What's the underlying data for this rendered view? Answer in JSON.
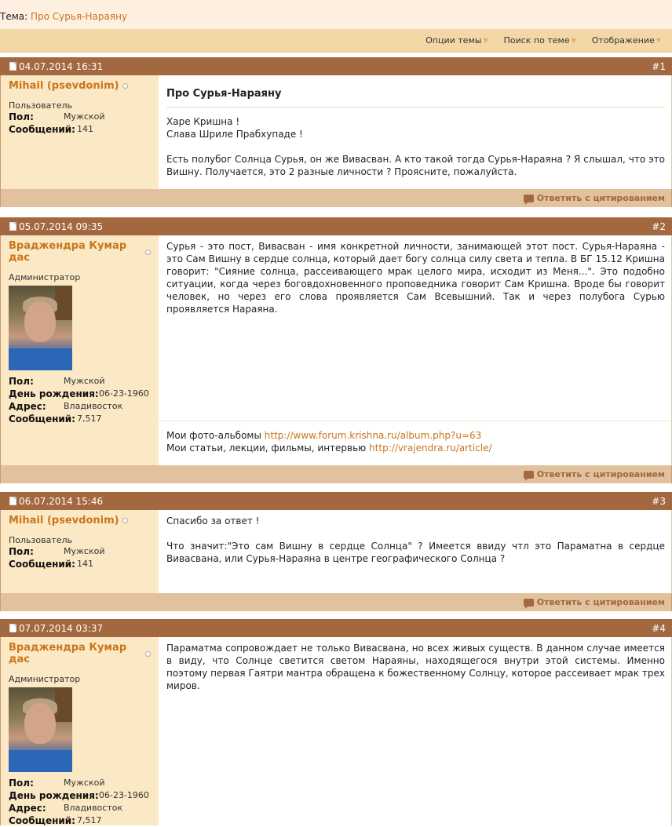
{
  "topic": {
    "prefix": "Тема:",
    "title": "Про Сурья-Нараяну"
  },
  "tools": [
    "Опции темы",
    "Поиск по теме",
    "Отображение"
  ],
  "posts": [
    {
      "date": "04.07.2014 16:31",
      "num": "#1",
      "username": "Mihail (psevdonim)",
      "usertitle": "Пользователь",
      "info": [
        {
          "k": "Пол:",
          "v": "Мужской"
        },
        {
          "k": "Сообщений:",
          "v": "141"
        }
      ],
      "title": "Про Сурья-Нараяну",
      "paragraphs": [
        "Харе Кришна !",
        "Слава Шриле Прабхупаде !",
        "",
        "Есть полубог Солнца Сурья, он же Вивасван. А кто такой тогда Сурья-Нараяна ? Я слышал, что это Вишну. Получается, это 2 разные личности ? Проясните, пожалуйста."
      ],
      "reply": "Ответить с цитированием"
    },
    {
      "date": "05.07.2014 09:35",
      "num": "#2",
      "username": "Враджендра Кумар дас",
      "usertitle": "Администратор",
      "info": [
        {
          "k": "Пол:",
          "v": "Мужской"
        },
        {
          "k": "День рождения:",
          "v": "06-23-1960"
        },
        {
          "k": "Адрес:",
          "v": "Владивосток"
        },
        {
          "k": "Сообщений:",
          "v": "7,517"
        }
      ],
      "paragraphs": [
        "Сурья - это пост, Вивасван - имя конкретной личности, занимающей этот пост. Сурья-Нараяна - это Сам Вишну в сердце солнца, который дает богу солнца силу света и тепла. В БГ 15.12 Кришна говорит: \"Сияние солнца, рассеивающего мрак целого мира, исходит из Меня...\". Это подобно ситуации, когда через боговдохновенного проповедника говорит Сам Кришна. Вроде бы говорит человек, но через его слова проявляется Сам Всевышний. Так и через полубога Сурью проявляется Нараяна."
      ],
      "sig": {
        "line1_label": "Мои фото-альбомы",
        "line1_link": "http://www.forum.krishna.ru/album.php?u=63",
        "line2_label": "Мои статьи, лекции, фильмы, интервью",
        "line2_link": "http://vrajendra.ru/article/"
      },
      "reply": "Ответить с цитированием"
    },
    {
      "date": "06.07.2014 15:46",
      "num": "#3",
      "username": "Mihail (psevdonim)",
      "usertitle": "Пользователь",
      "info": [
        {
          "k": "Пол:",
          "v": "Мужской"
        },
        {
          "k": "Сообщений:",
          "v": "141"
        }
      ],
      "paragraphs": [
        "Спасибо за ответ !",
        "",
        "Что значит:\"Это сам Вишну в сердце Солнца\" ? Имеется ввиду чтл это Параматна в сердце Вивасвана, или Сурья-Нараяна в центре географического Солнца ?"
      ],
      "reply": "Ответить с цитированием"
    },
    {
      "date": "07.07.2014 03:37",
      "num": "#4",
      "username": "Враджендра Кумар дас",
      "usertitle": "Администратор",
      "info": [
        {
          "k": "Пол:",
          "v": "Мужской"
        },
        {
          "k": "День рождения:",
          "v": "06-23-1960"
        },
        {
          "k": "Адрес:",
          "v": "Владивосток"
        },
        {
          "k": "Сообщений:",
          "v": "7,517"
        }
      ],
      "paragraphs": [
        "Параматма сопровождает не только Вивасвана, но всех живых существ. В данном случае имеется в виду, что Солнце светится светом Нараяны, находящегося внутри этой системы. Именно поэтому первая Гаятри мантра обращена к божественному Солнцу, которое рассеивает мрак трех миров."
      ]
    }
  ]
}
